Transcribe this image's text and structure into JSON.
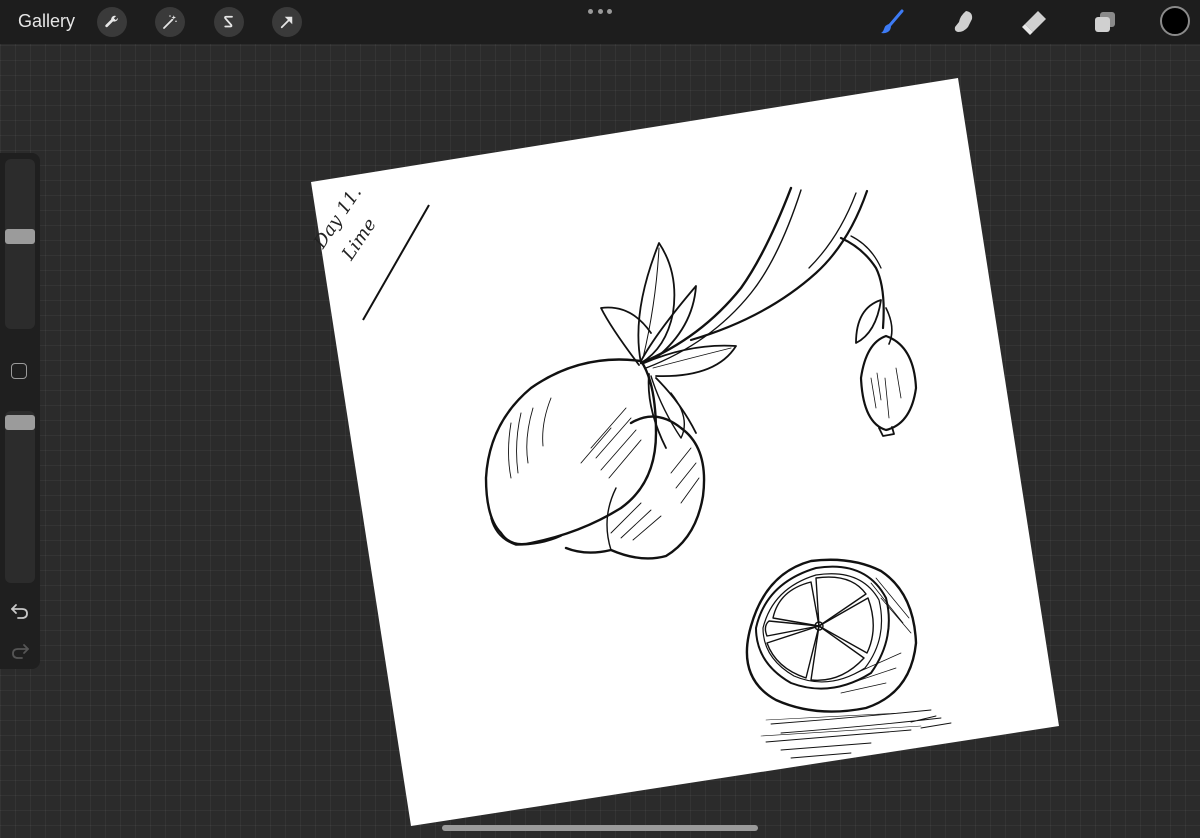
{
  "topbar": {
    "gallery_label": "Gallery",
    "left_tools": [
      "wrench-icon",
      "magic-wand-icon",
      "selection-icon",
      "transform-arrow-icon"
    ],
    "right_tools": [
      "brush-icon",
      "smudge-icon",
      "eraser-icon",
      "layers-icon"
    ],
    "active_tool": "brush-icon",
    "active_color": "#000000",
    "accent_color": "#3d7bf5"
  },
  "sidebar": {
    "brush_size": 0.55,
    "opacity": 1.0
  },
  "canvas": {
    "signature_line1": "Day 11.",
    "signature_line2": "Lime"
  }
}
